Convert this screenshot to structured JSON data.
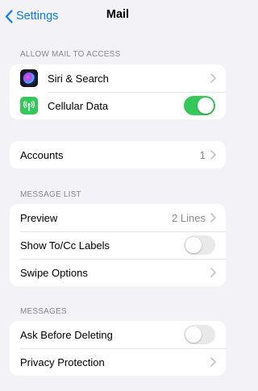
{
  "nav": {
    "back_label": "Settings",
    "title": "Mail"
  },
  "sections": {
    "allow_access": {
      "header": "ALLOW MAIL TO ACCESS",
      "rows": [
        {
          "label": "Siri & Search",
          "icon": "siri-icon",
          "accessory": "chevron"
        },
        {
          "label": "Cellular Data",
          "icon": "cellular-antenna-icon",
          "toggle": true
        }
      ]
    },
    "accounts": {
      "rows": [
        {
          "label": "Accounts",
          "value": "1",
          "accessory": "chevron"
        }
      ]
    },
    "message_list": {
      "header": "MESSAGE LIST",
      "rows": [
        {
          "label": "Preview",
          "value": "2 Lines",
          "accessory": "chevron"
        },
        {
          "label": "Show To/Cc Labels",
          "toggle": false
        },
        {
          "label": "Swipe Options",
          "accessory": "chevron"
        }
      ]
    },
    "messages": {
      "header": "MESSAGES",
      "rows": [
        {
          "label": "Ask Before Deleting",
          "toggle": false
        },
        {
          "label": "Privacy Protection",
          "accessory": "chevron"
        }
      ]
    }
  },
  "colors": {
    "accent": "#0a7aff",
    "toggle_on": "#34c759",
    "background": "#f2f2f7",
    "secondary_text": "#8a8a8e"
  }
}
